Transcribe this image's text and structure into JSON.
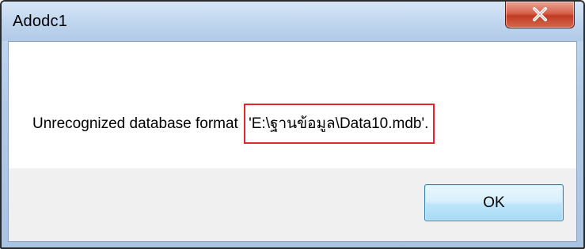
{
  "window": {
    "title": "Adodc1",
    "close_icon": "close-x-icon"
  },
  "message": {
    "prefix": "Unrecognized database format ",
    "path": "'E:\\ฐานข้อมูล\\Data10.mdb'."
  },
  "buttons": {
    "ok_label": "OK"
  },
  "colors": {
    "highlight_border": "#e3262d",
    "close_button": "#c13a22",
    "ok_button_border": "#3c7fb1"
  }
}
